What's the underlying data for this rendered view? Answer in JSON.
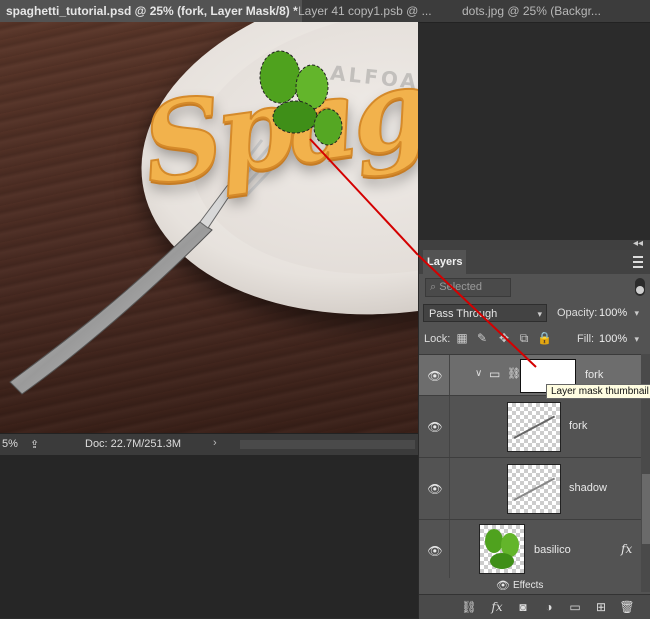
{
  "tabs": [
    {
      "label": "spaghetti_tutorial.psd @ 25% (fork, Layer Mask/8) *",
      "active": true
    },
    {
      "label": "Layer 41 copy1.psb @ ...",
      "active": false
    },
    {
      "label": "dots.jpg @ 25% (Backgr...",
      "active": false
    }
  ],
  "canvas": {
    "title_text": "Spaghetti",
    "watermark": "ALFOART"
  },
  "status": {
    "zoom": "5%",
    "doc": "Doc: 22.7M/251.3M"
  },
  "layers_panel": {
    "tab_label": "Layers",
    "filter_placeholder": "Selected",
    "blend_mode": "Pass Through",
    "opacity_label": "Opacity:",
    "opacity_value": "100%",
    "lock_label": "Lock:",
    "fill_label": "Fill:",
    "fill_value": "100%",
    "tooltip": "Layer mask thumbnail",
    "layers": [
      {
        "name": "fork",
        "type": "group"
      },
      {
        "name": "fork",
        "type": "layer"
      },
      {
        "name": "shadow",
        "type": "layer"
      },
      {
        "name": "basilico",
        "type": "layer",
        "fx": "fx"
      },
      {
        "name": "Effects",
        "type": "effects"
      }
    ]
  },
  "colors": {
    "accent_red": "#d40000"
  }
}
